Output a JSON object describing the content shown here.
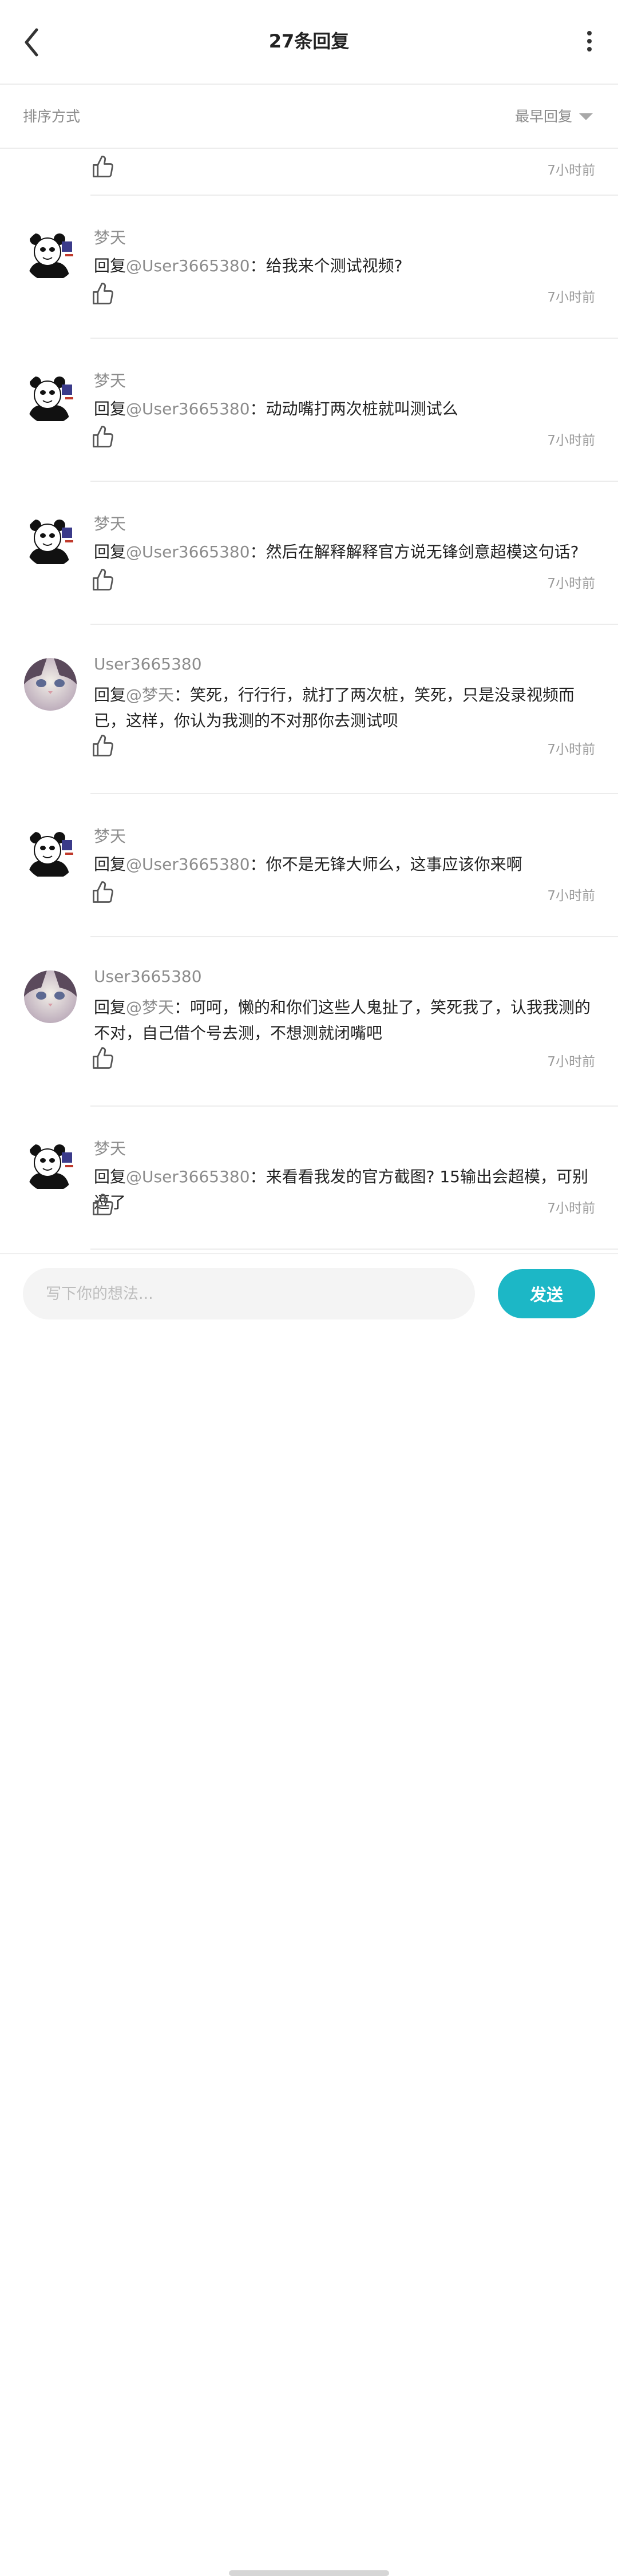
{
  "header": {
    "title": "27条回复"
  },
  "sort": {
    "label": "排序方式",
    "value": "最早回复"
  },
  "first_time": "7小时前",
  "comments": [
    {
      "user": "梦天",
      "avatar": "panda-meme",
      "prefix": "回复",
      "mention": "@User3665380",
      "sep": "：",
      "text": "给我来个测试视频?",
      "time": "7小时前"
    },
    {
      "user": "梦天",
      "avatar": "panda-meme",
      "prefix": "回复",
      "mention": "@User3665380",
      "sep": "：",
      "text": "动动嘴打两次桩就叫测试么",
      "time": "7小时前"
    },
    {
      "user": "梦天",
      "avatar": "panda-meme",
      "prefix": "回复",
      "mention": "@User3665380",
      "sep": "：",
      "text": "然后在解释解释官方说无锋剑意超模这句话?",
      "time": "7小时前"
    },
    {
      "user": "User3665380",
      "avatar": "cat",
      "prefix": "回复",
      "mention": "@梦天",
      "sep": "：",
      "text": "笑死，行行行，就打了两次桩，笑死，只是没录视频而已，这样，你认为我测的不对那你去测试呗",
      "time": "7小时前"
    },
    {
      "user": "梦天",
      "avatar": "panda-meme",
      "prefix": "回复",
      "mention": "@User3665380",
      "sep": "：",
      "text": "你不是无锋大师么，这事应该你来啊",
      "time": "7小时前"
    },
    {
      "user": "User3665380",
      "avatar": "cat",
      "prefix": "回复",
      "mention": "@梦天",
      "sep": "：",
      "text": "呵呵，懒的和你们这些人鬼扯了，笑死我了，认我我测的不对，自己借个号去测，不想测就闭嘴吧",
      "time": "7小时前"
    },
    {
      "user": "梦天",
      "avatar": "panda-meme",
      "prefix": "回复",
      "mention": "@User3665380",
      "sep": "：",
      "text": "来看看我发的官方截图? 15输出会超模，可别逗了",
      "time": "7小时前"
    }
  ],
  "input": {
    "placeholder": "写下你的想法..."
  },
  "send_label": "发送"
}
